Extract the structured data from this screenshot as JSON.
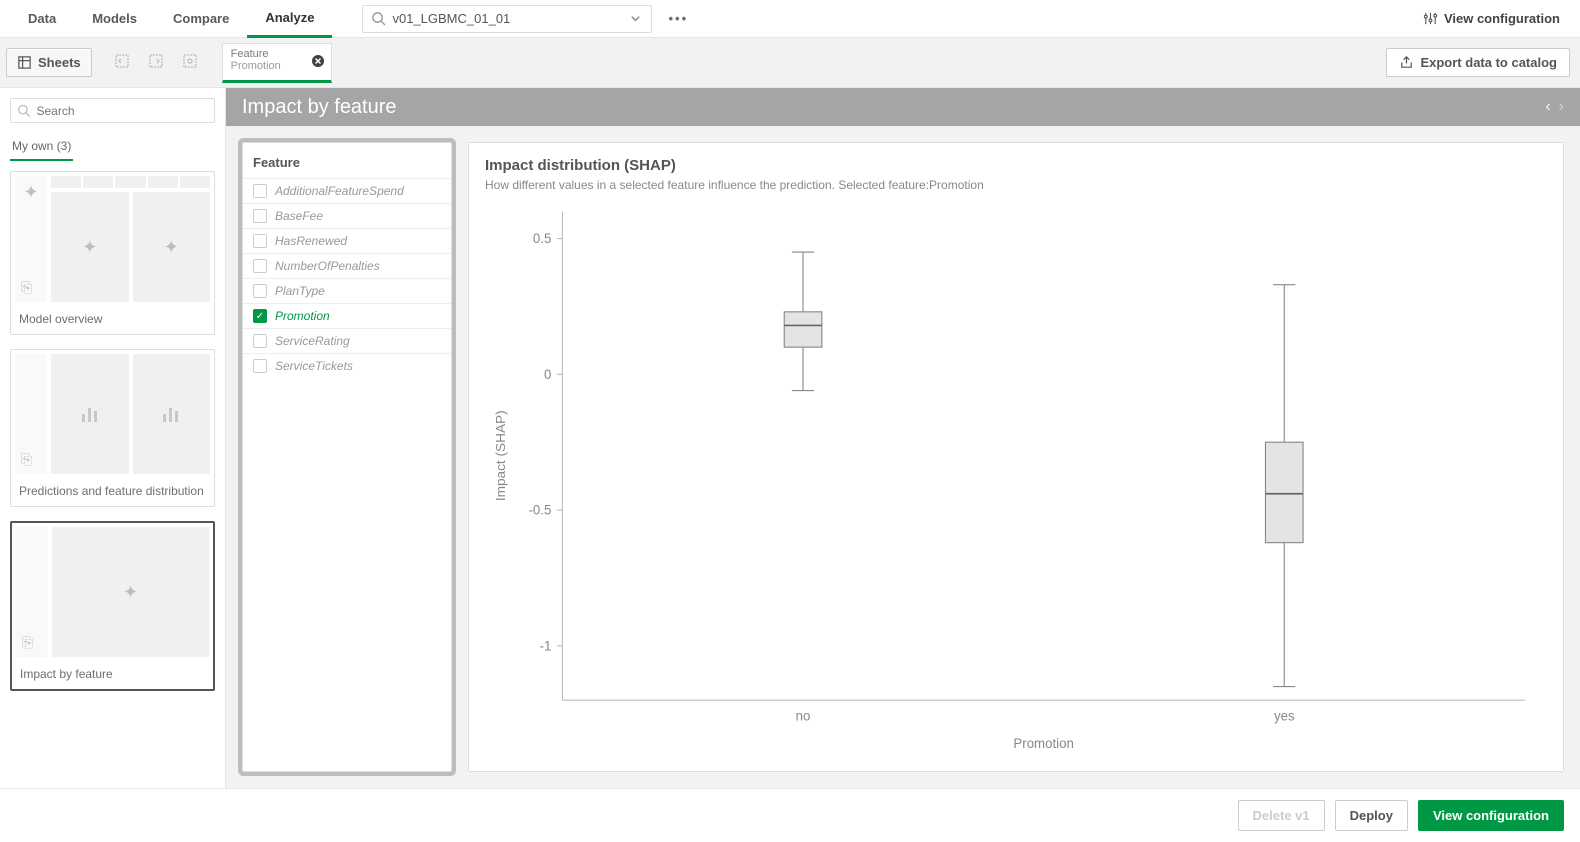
{
  "nav": {
    "tabs": [
      "Data",
      "Models",
      "Compare",
      "Analyze"
    ],
    "active": 3,
    "model": "v01_LGBMC_01_01",
    "viewcfg": "View configuration"
  },
  "toolbar": {
    "sheets": "Sheets",
    "feature_tab": {
      "line1": "Feature",
      "line2": "Promotion"
    },
    "export": "Export data to catalog"
  },
  "sidebar": {
    "search_placeholder": "Search",
    "own_label": "My own (3)",
    "cards": [
      {
        "title": "Model overview"
      },
      {
        "title": "Predictions and feature distribution"
      },
      {
        "title": "Impact by feature"
      }
    ],
    "selected": 2
  },
  "page_title": "Impact by feature",
  "feature_panel": {
    "title": "Feature",
    "items": [
      "AdditionalFeatureSpend",
      "BaseFee",
      "HasRenewed",
      "NumberOfPenalties",
      "PlanType",
      "Promotion",
      "ServiceRating",
      "ServiceTickets"
    ],
    "selected": "Promotion"
  },
  "chart": {
    "title": "Impact distribution (SHAP)",
    "subtitle": "How different values in a selected feature influence the prediction. Selected feature:Promotion",
    "xlabel": "Promotion",
    "ylabel": "Impact (SHAP)"
  },
  "chart_data": {
    "type": "boxplot",
    "title": "Impact distribution (SHAP)",
    "xlabel": "Promotion",
    "ylabel": "Impact (SHAP)",
    "ylim": [
      -1.2,
      0.6
    ],
    "yticks": [
      -1,
      -0.5,
      0,
      0.5
    ],
    "categories": [
      "no",
      "yes"
    ],
    "series": [
      {
        "name": "no",
        "min": -0.06,
        "q1": 0.1,
        "median": 0.18,
        "q3": 0.23,
        "max": 0.45
      },
      {
        "name": "yes",
        "min": -1.15,
        "q1": -0.62,
        "median": -0.44,
        "q3": -0.25,
        "max": 0.33
      }
    ]
  },
  "footer": {
    "delete": "Delete v1",
    "deploy": "Deploy",
    "viewcfg": "View configuration"
  }
}
